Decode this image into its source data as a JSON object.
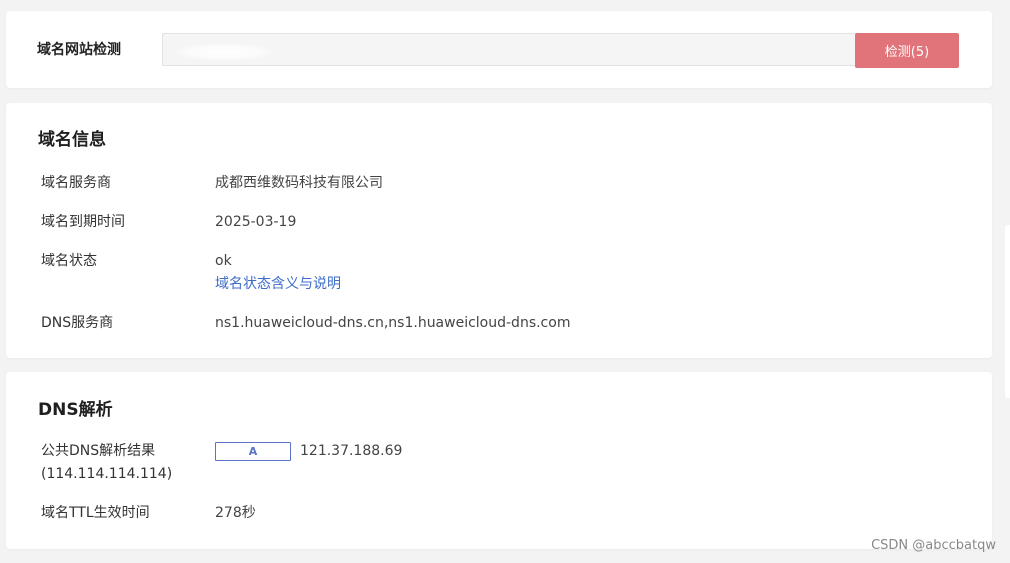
{
  "search": {
    "label": "域名网站检测",
    "value": "",
    "button_label": "检测(5)"
  },
  "domain_info": {
    "title": "域名信息",
    "rows": [
      {
        "label": "域名服务商",
        "value": "成都西维数码科技有限公司"
      },
      {
        "label": "域名到期时间",
        "value": "2025-03-19"
      },
      {
        "label": "域名状态",
        "value": "ok",
        "link": "域名状态含义与说明"
      },
      {
        "label": "DNS服务商",
        "value": "ns1.huaweicloud-dns.cn,ns1.huaweicloud-dns.com"
      }
    ]
  },
  "dns_resolution": {
    "title": "DNS解析",
    "public_result_label_line1": "公共DNS解析结果",
    "public_result_label_line2": "(114.114.114.114)",
    "record_type": "A",
    "record_value": "121.37.188.69",
    "ttl_label": "域名TTL生效时间",
    "ttl_value": "278秒"
  },
  "watermark": "CSDN @abccbatqw",
  "colors": {
    "accent_button": "#e0747a",
    "link": "#3e6dc9",
    "badge_border": "#5b72c9",
    "page_bg": "#f3f3f3"
  }
}
